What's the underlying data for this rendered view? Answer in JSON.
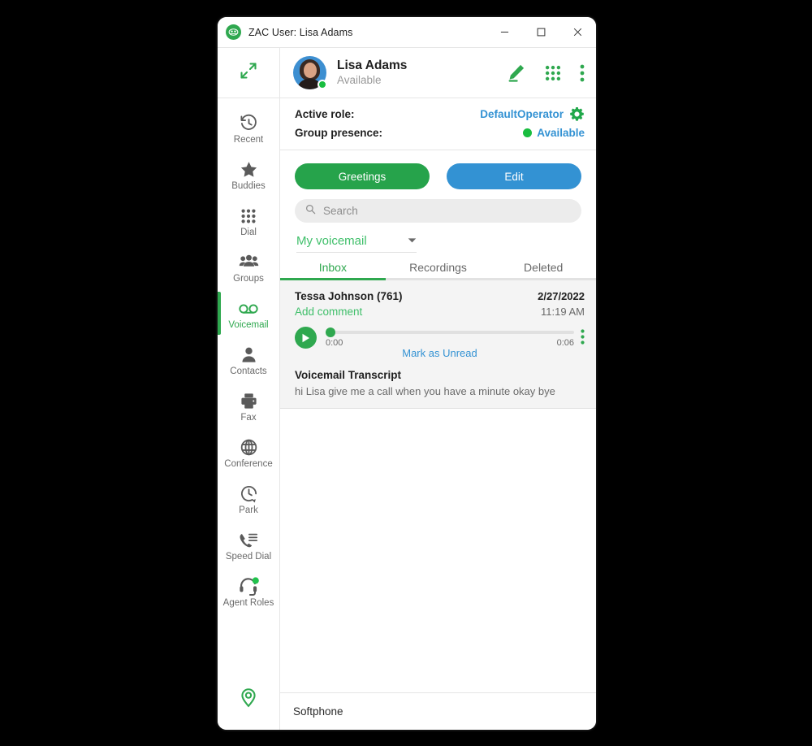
{
  "window": {
    "title": "ZAC User: Lisa Adams",
    "app_icon": "zac-logo-icon",
    "minimize_icon": "minimize-icon",
    "maximize_icon": "maximize-icon",
    "close_icon": "close-icon"
  },
  "sidebar": {
    "expand_icon": "expand-arrows-icon",
    "items": [
      {
        "label": "Recent",
        "icon": "clock-history-icon",
        "active": false
      },
      {
        "label": "Buddies",
        "icon": "star-icon",
        "active": false
      },
      {
        "label": "Dial",
        "icon": "dialpad-icon",
        "active": false
      },
      {
        "label": "Groups",
        "icon": "people-group-icon",
        "active": false
      },
      {
        "label": "Voicemail",
        "icon": "voicemail-icon",
        "active": true
      },
      {
        "label": "Contacts",
        "icon": "person-icon",
        "active": false
      },
      {
        "label": "Fax",
        "icon": "printer-fax-icon",
        "active": false
      },
      {
        "label": "Conference",
        "icon": "globe-icon",
        "active": false
      },
      {
        "label": "Park",
        "icon": "park-clock-icon",
        "active": false
      },
      {
        "label": "Speed Dial",
        "icon": "speed-dial-icon",
        "active": false
      },
      {
        "label": "Agent Roles",
        "icon": "headset-icon",
        "active": false
      }
    ],
    "bottom_icon": "location-pin-icon"
  },
  "user": {
    "name": "Lisa Adams",
    "status": "Available",
    "avatar": "user-avatar-photo",
    "status_color": "#19bd3f",
    "actions": [
      {
        "name": "edit-icon"
      },
      {
        "name": "dialpad-icon"
      },
      {
        "name": "overflow-menu-icon"
      }
    ]
  },
  "role": {
    "active_role_label": "Active role:",
    "active_role_value": "DefaultOperator",
    "settings_icon": "gear-icon",
    "group_presence_label": "Group presence:",
    "group_presence_value": "Available",
    "presence_color": "#19bd3f",
    "link_color": "#3392d3"
  },
  "actions": {
    "greetings_label": "Greetings",
    "greetings_color": "#26a34b",
    "edit_label": "Edit",
    "edit_color": "#3392d3"
  },
  "search": {
    "placeholder": "Search",
    "value": "",
    "icon": "search-icon"
  },
  "mailbox": {
    "selected": "My voicemail",
    "caret_icon": "chevron-down-icon"
  },
  "tabs": [
    {
      "label": "Inbox",
      "active": true
    },
    {
      "label": "Recordings",
      "active": false
    },
    {
      "label": "Deleted",
      "active": false
    }
  ],
  "voicemail": {
    "from": "Tessa Johnson (761)",
    "add_comment_label": "Add comment",
    "date": "2/27/2022",
    "time": "11:19 AM",
    "play_icon": "play-icon",
    "kebab_icon": "overflow-menu-icon",
    "elapsed": "0:00",
    "duration": "0:06",
    "mark_unread_label": "Mark as Unread",
    "transcript_title": "Voicemail Transcript",
    "transcript_text": "hi Lisa give me a call when you have a minute okay bye"
  },
  "footer": {
    "label": "Softphone"
  }
}
